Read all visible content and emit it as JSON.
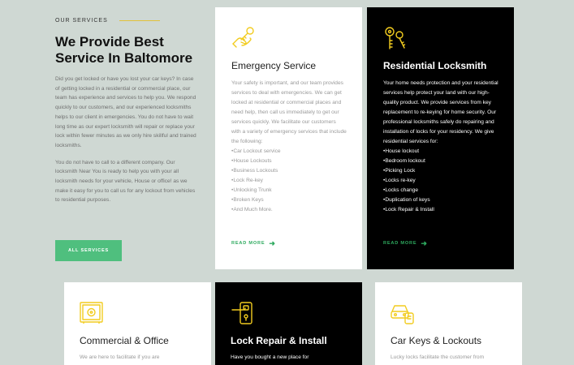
{
  "intro": {
    "eyebrow": "OUR SERVICES",
    "title_line1": "We Provide Best",
    "title_line2": "Service In Baltomore",
    "para1": "Did you get locked or have you lost your car keys? In case of getting locked in a residential or commercial place, our team has experience and services to help you. We respond quickly to our customers, and our experienced locksmiths helps to our client in emergencies. You do not have to wait long time as our expert locksmith will repair or replace your lock within fewer minutes as we only hire skillful and trained locksmiths.",
    "para2": "You do not have to call to a different company. Our locksmith Near You is ready to help you with your all locksmith needs for your vehicle, House or office! as we make it easy for you to call us for any lockout from vehicles to residential purposes.",
    "button": "ALL SERVICES"
  },
  "colors": {
    "accent_green": "#4fbf7e",
    "icon_yellow": "#f2cc1f",
    "background": "#cfd8d3"
  },
  "cards": [
    {
      "icon": "hand-key-icon",
      "title": "Emergency Service",
      "body": "Your safety is important, and our team provides services to deal with emergencies. We can get locked at residential or commercial places and need help, then call us immediately to get our services quickly. We facilitate our customers with a variety of emergency services that include the following:",
      "list": [
        "Car Lockout service",
        "House Lockouts",
        "Business Lockouts",
        "Lock Re-key",
        "Unlocking Trunk",
        "Broken Keys",
        "And Much More."
      ],
      "link": "READ MORE"
    },
    {
      "icon": "keys-icon",
      "title": "Residential Locksmith",
      "body": "Your home needs protection and your residential services help protect your land with our high-quality product. We provide services from key replacement to re-keying for home security. Our professional locksmiths safely do repairing and installation of locks for your residency. We give residential services for:",
      "list": [
        "House lockout",
        "Bedroom lockout",
        "Picking Lock",
        "Locks re-key",
        "Locks change",
        "Duplication of keys",
        "Lock Repair & Install"
      ],
      "link": "READ MORE"
    },
    {
      "icon": "safe-icon",
      "title": "Commercial & Office",
      "body": "We are here to facilitate if you are"
    },
    {
      "icon": "door-lock-icon",
      "title": "Lock Repair & Install",
      "body": "Have you bought a new place for"
    },
    {
      "icon": "car-key-icon",
      "title": "Car Keys & Lockouts",
      "body": "Lucky locks facilitate the customer from"
    }
  ]
}
